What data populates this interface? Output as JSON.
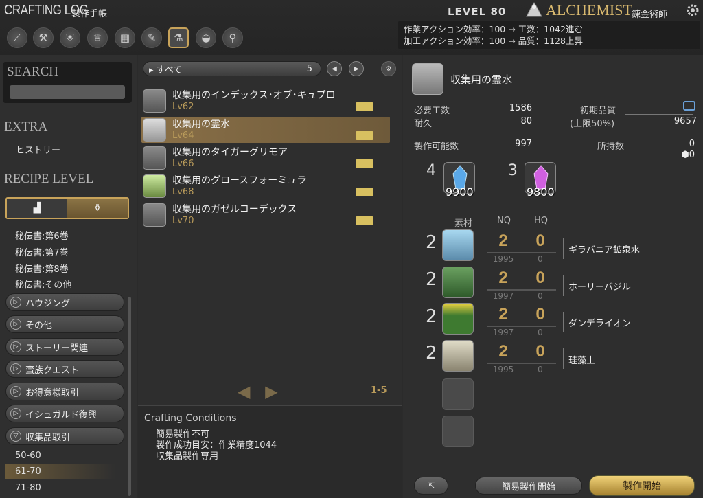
{
  "header": {
    "title": "CRAFTING LOG",
    "subtitle": "製作手帳",
    "level": "LEVEL 80",
    "job": "ALCHEMIST",
    "job_jp": "錬金術師",
    "efficiency_line1": "作業アクション効率：100 → 工数：1042進む",
    "efficiency_line2": "加工アクション効率：100 → 品質：1128上昇"
  },
  "toolbar": {
    "icons": [
      "carpenter-icon",
      "blacksmith-icon",
      "armorer-icon",
      "goldsmith-icon",
      "leatherworker-icon",
      "weaver-icon",
      "alchemist-icon",
      "culinarian-icon",
      "search-icon"
    ]
  },
  "left": {
    "search_label": "SEARCH",
    "extra_label": "EXTRA",
    "history": "ヒストリー",
    "recipe_level_label": "RECIPE LEVEL",
    "books": [
      "秘伝書:第6巻",
      "秘伝書:第7巻",
      "秘伝書:第8巻",
      "秘伝書:その他"
    ],
    "categories": [
      "ハウジング",
      "その他",
      "ストーリー関連",
      "蛮族クエスト",
      "お得意様取引",
      "イシュガルド復興",
      "収集品取引"
    ],
    "ranges": [
      "50-60",
      "61-70",
      "71-80"
    ]
  },
  "middle": {
    "filter_label": "すべて",
    "filter_count": "5",
    "recipes": [
      {
        "name": "収集用のインデックス･オブ･キュプロ",
        "level": "Lv62"
      },
      {
        "name": "収集用の霊水",
        "level": "Lv64"
      },
      {
        "name": "収集用のタイガーグリモア",
        "level": "Lv66"
      },
      {
        "name": "収集用のグロースフォーミュラ",
        "level": "Lv68"
      },
      {
        "name": "収集用のガゼルコーデックス",
        "level": "Lv70"
      }
    ],
    "page_range": "1-5"
  },
  "conditions": {
    "title": "Crafting Conditions",
    "lines": [
      "簡易製作不可",
      "製作成功目安：作業精度1044",
      "収集品製作専用"
    ]
  },
  "detail": {
    "item_name": "収集用の霊水",
    "req_progress_label": "必要工数",
    "req_progress": "1586",
    "durability_label": "耐久",
    "durability": "80",
    "initial_quality_label": "初期品質",
    "quality_cap_label": "(上限50%)",
    "quality_max": "9657",
    "craftable_label": "製作可能数",
    "craftable": "997",
    "owned_label": "所持数",
    "owned": "0",
    "owned_hq": "0",
    "crystals": [
      {
        "required": "4",
        "owned": "9900",
        "color": "#5aa8e8",
        "icon": "ice-crystal-icon"
      },
      {
        "required": "3",
        "owned": "9800",
        "color": "#d060e0",
        "icon": "lightning-crystal-icon"
      }
    ],
    "mat_headers": {
      "material": "素材",
      "nq": "NQ",
      "hq": "HQ"
    },
    "materials": [
      {
        "qty": "2",
        "nq": "2",
        "hq": "0",
        "nq_owned": "1995",
        "hq_owned": "0",
        "name": "ギラバニア鉱泉水",
        "icon": "water-bottle-icon"
      },
      {
        "qty": "2",
        "nq": "2",
        "hq": "0",
        "nq_owned": "1997",
        "hq_owned": "0",
        "name": "ホーリーバジル",
        "icon": "basil-icon"
      },
      {
        "qty": "2",
        "nq": "2",
        "hq": "0",
        "nq_owned": "1997",
        "hq_owned": "0",
        "name": "ダンデライオン",
        "icon": "dandelion-icon"
      },
      {
        "qty": "2",
        "nq": "2",
        "hq": "0",
        "nq_owned": "1995",
        "hq_owned": "0",
        "name": "珪藻土",
        "icon": "sack-icon"
      }
    ]
  },
  "buttons": {
    "quick_synthesis": "簡易製作開始",
    "synthesize": "製作開始"
  }
}
